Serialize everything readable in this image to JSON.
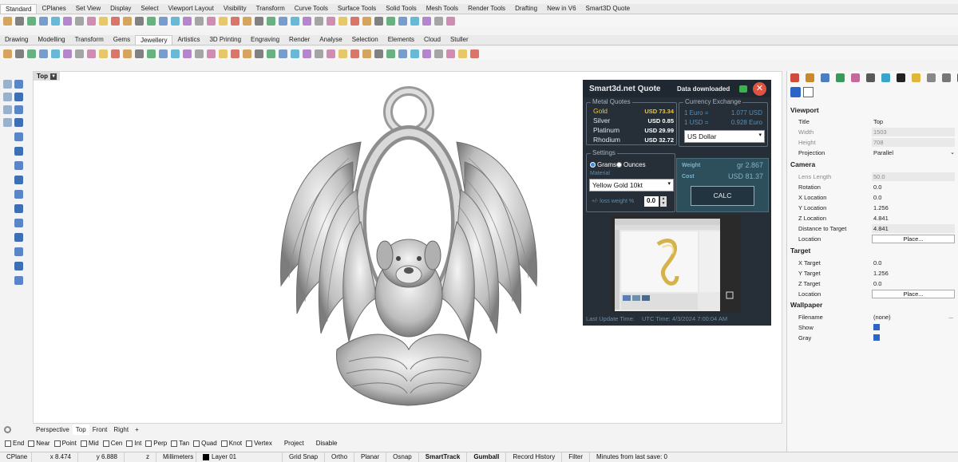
{
  "top_tabs": [
    "Standard",
    "CPlanes",
    "Set View",
    "Display",
    "Select",
    "Viewport Layout",
    "Visibility",
    "Transform",
    "Curve Tools",
    "Surface Tools",
    "Solid Tools",
    "Mesh Tools",
    "Render Tools",
    "Drafting",
    "New in V6",
    "Smart3D Quote"
  ],
  "second_tabs": [
    "Drawing",
    "Modelling",
    "Transform",
    "Gems",
    "Jewellery",
    "Artistics",
    "3D Printing",
    "Engraving",
    "Render",
    "Analyse",
    "Selection",
    "Elements",
    "Cloud",
    "Stuller"
  ],
  "viewport": {
    "title": "Top"
  },
  "viewport_tabs": [
    "Perspective",
    "Top",
    "Front",
    "Right"
  ],
  "plugin": {
    "title": "Smart3d.net Quote",
    "status": "Data downloaded",
    "metal_quotes_label": "Metal Quotes",
    "metals": [
      {
        "name": "Gold",
        "value": "USD 73.34"
      },
      {
        "name": "Silver",
        "value": "USD 0.85"
      },
      {
        "name": "Platinum",
        "value": "USD 29.99"
      },
      {
        "name": "Rhodium",
        "value": "USD 32.72"
      }
    ],
    "currency_label": "Currency Exchange",
    "rates": [
      {
        "lhs": "1 Euro =",
        "rhs": "1.077 USD"
      },
      {
        "lhs": "1 USD =",
        "rhs": "0.928 Euro"
      }
    ],
    "currency_select": "US Dollar",
    "settings_label": "Settings",
    "grams_label": "Grams",
    "ounces_label": "Ounces",
    "material_label": "Material",
    "material_select": "Yellow Gold 10kt",
    "loss_label": "+/- loss weight %",
    "loss_value": "0.0",
    "weight_label": "Weight",
    "weight_value": "gr 2.867",
    "cost_label": "Cost",
    "cost_value": "USD 81.37",
    "calc_label": "CALC",
    "last_update_label": "Last Update Time:",
    "utc_label": "UTC Time: 4/3/2024 7:00:04 AM"
  },
  "properties": {
    "viewport_section": "Viewport",
    "title_key": "Title",
    "title_val": "Top",
    "width_key": "Width",
    "width_val": "1503",
    "height_key": "Height",
    "height_val": "708",
    "projection_key": "Projection",
    "projection_val": "Parallel",
    "camera_section": "Camera",
    "lens_key": "Lens Length",
    "lens_val": "50.0",
    "rotation_key": "Rotation",
    "rotation_val": "0.0",
    "xloc_key": "X Location",
    "xloc_val": "0.0",
    "yloc_key": "Y Location",
    "yloc_val": "1.256",
    "zloc_key": "Z Location",
    "zloc_val": "4.841",
    "dist_key": "Distance to Target",
    "dist_val": "4.841",
    "location_key": "Location",
    "place_label": "Place...",
    "target_section": "Target",
    "xt_key": "X Target",
    "xt_val": "0.0",
    "yt_key": "Y Target",
    "yt_val": "1.256",
    "zt_key": "Z Target",
    "zt_val": "0.0",
    "tloc_key": "Location",
    "wallpaper_section": "Wallpaper",
    "filename_key": "Filename",
    "filename_val": "(none)",
    "browse_label": "...",
    "show_key": "Show",
    "gray_key": "Gray"
  },
  "osnaps": [
    "End",
    "Near",
    "Point",
    "Mid",
    "Cen",
    "Int",
    "Perp",
    "Tan",
    "Quad",
    "Knot",
    "Vertex",
    "Project",
    "Disable"
  ],
  "status": {
    "cplane": "CPlane",
    "x": "x 8.474",
    "y": "y 6.888",
    "z": "z",
    "units": "Millimeters",
    "layer": "Layer 01",
    "grid_snap": "Grid Snap",
    "ortho": "Ortho",
    "planar": "Planar",
    "osnap": "Osnap",
    "smarttrack": "SmartTrack",
    "gumball": "Gumball",
    "record_history": "Record History",
    "filter": "Filter",
    "minutes": "Minutes from last save: 0"
  },
  "colors": {
    "accent": "#2b63c7",
    "plugin_bg": "#262e37",
    "gold_text": "#f2c531",
    "close_red": "#e0533f",
    "status_green": "#3bb34a"
  }
}
